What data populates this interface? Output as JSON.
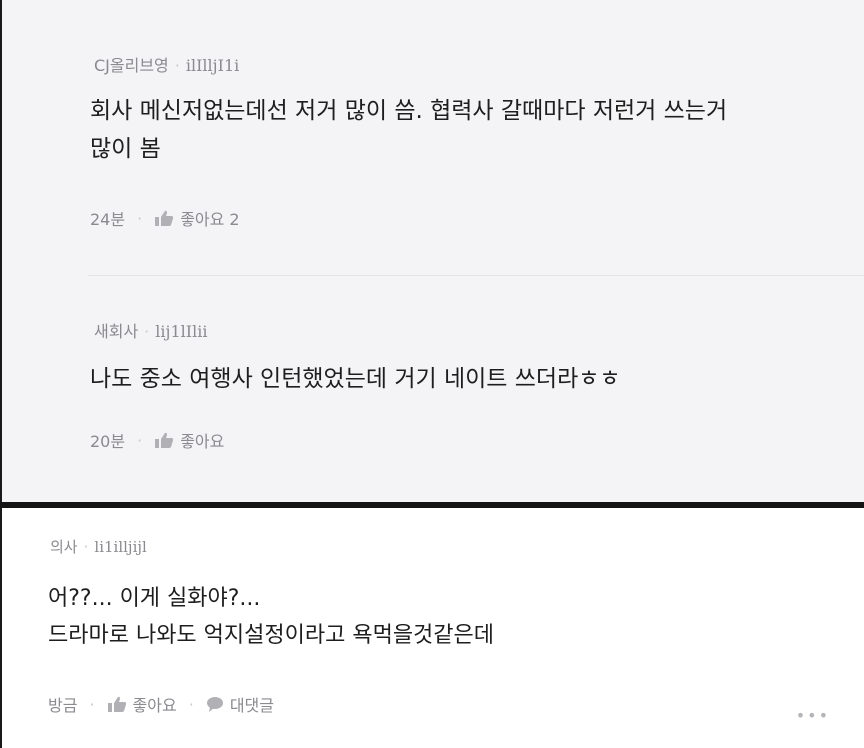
{
  "comments": [
    {
      "company": "CJ올리브영",
      "nickname": "ilIlljI1i",
      "body_line1": "회사 메신저없는데선 저거 많이 씀. 협력사 갈때마다 저런거 쓰는거",
      "body_line2": "많이 봄",
      "time": "24분",
      "like_label": "좋아요 2"
    },
    {
      "company": "새회사",
      "nickname": "lij1lIlii",
      "body_line1": "나도 중소 여행사 인턴했었는데 거기 네이트 쓰더라ㅎㅎ",
      "time": "20분",
      "like_label": "좋아요"
    },
    {
      "company": "의사",
      "nickname": "li1illjijl",
      "body_line1": "어??... 이게 실화야?...",
      "body_line2": "드라마로 나와도 억지설정이라고 욕먹을것같은데",
      "time": "방금",
      "like_label": "좋아요",
      "reply_label": "대댓글"
    }
  ],
  "icons": {
    "like": "thumbs-up-icon",
    "reply": "speech-bubble-icon",
    "more": "more-dots-icon"
  },
  "colors": {
    "panel_bg": "#f4f4f6",
    "divider": "#141414",
    "meta": "#8a8a8f",
    "text": "#1e1e1e"
  }
}
